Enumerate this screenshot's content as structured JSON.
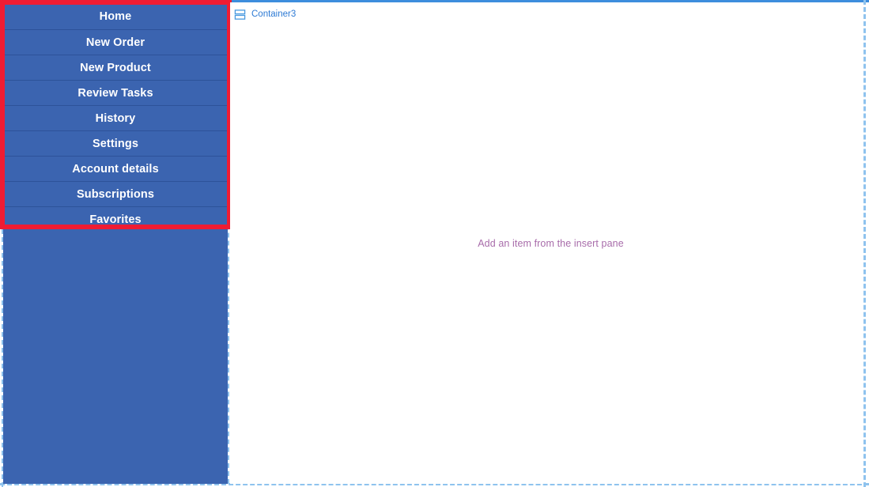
{
  "window": {
    "frame_accent_color": "#3d8ddd",
    "frame_dash_color": "#8fc3ee"
  },
  "sidebar": {
    "background_color": "#3b64b0",
    "separator_color": "#2d5299",
    "text_color": "#ffffff",
    "items": [
      {
        "label": "Home"
      },
      {
        "label": "New Order"
      },
      {
        "label": "New Product"
      },
      {
        "label": "Review Tasks"
      },
      {
        "label": "History"
      },
      {
        "label": "Settings"
      },
      {
        "label": "Account details"
      },
      {
        "label": "Subscriptions"
      },
      {
        "label": "Favorites"
      }
    ]
  },
  "annotation": {
    "highlight_color": "#ef1c33",
    "target": "navigation-menu"
  },
  "content": {
    "container": {
      "icon": "stacked-rows-icon",
      "label": "Container3",
      "label_color": "#2d7ad4"
    },
    "empty_state": {
      "message": "Add an item from the insert pane",
      "text_color": "#a86caa"
    }
  }
}
